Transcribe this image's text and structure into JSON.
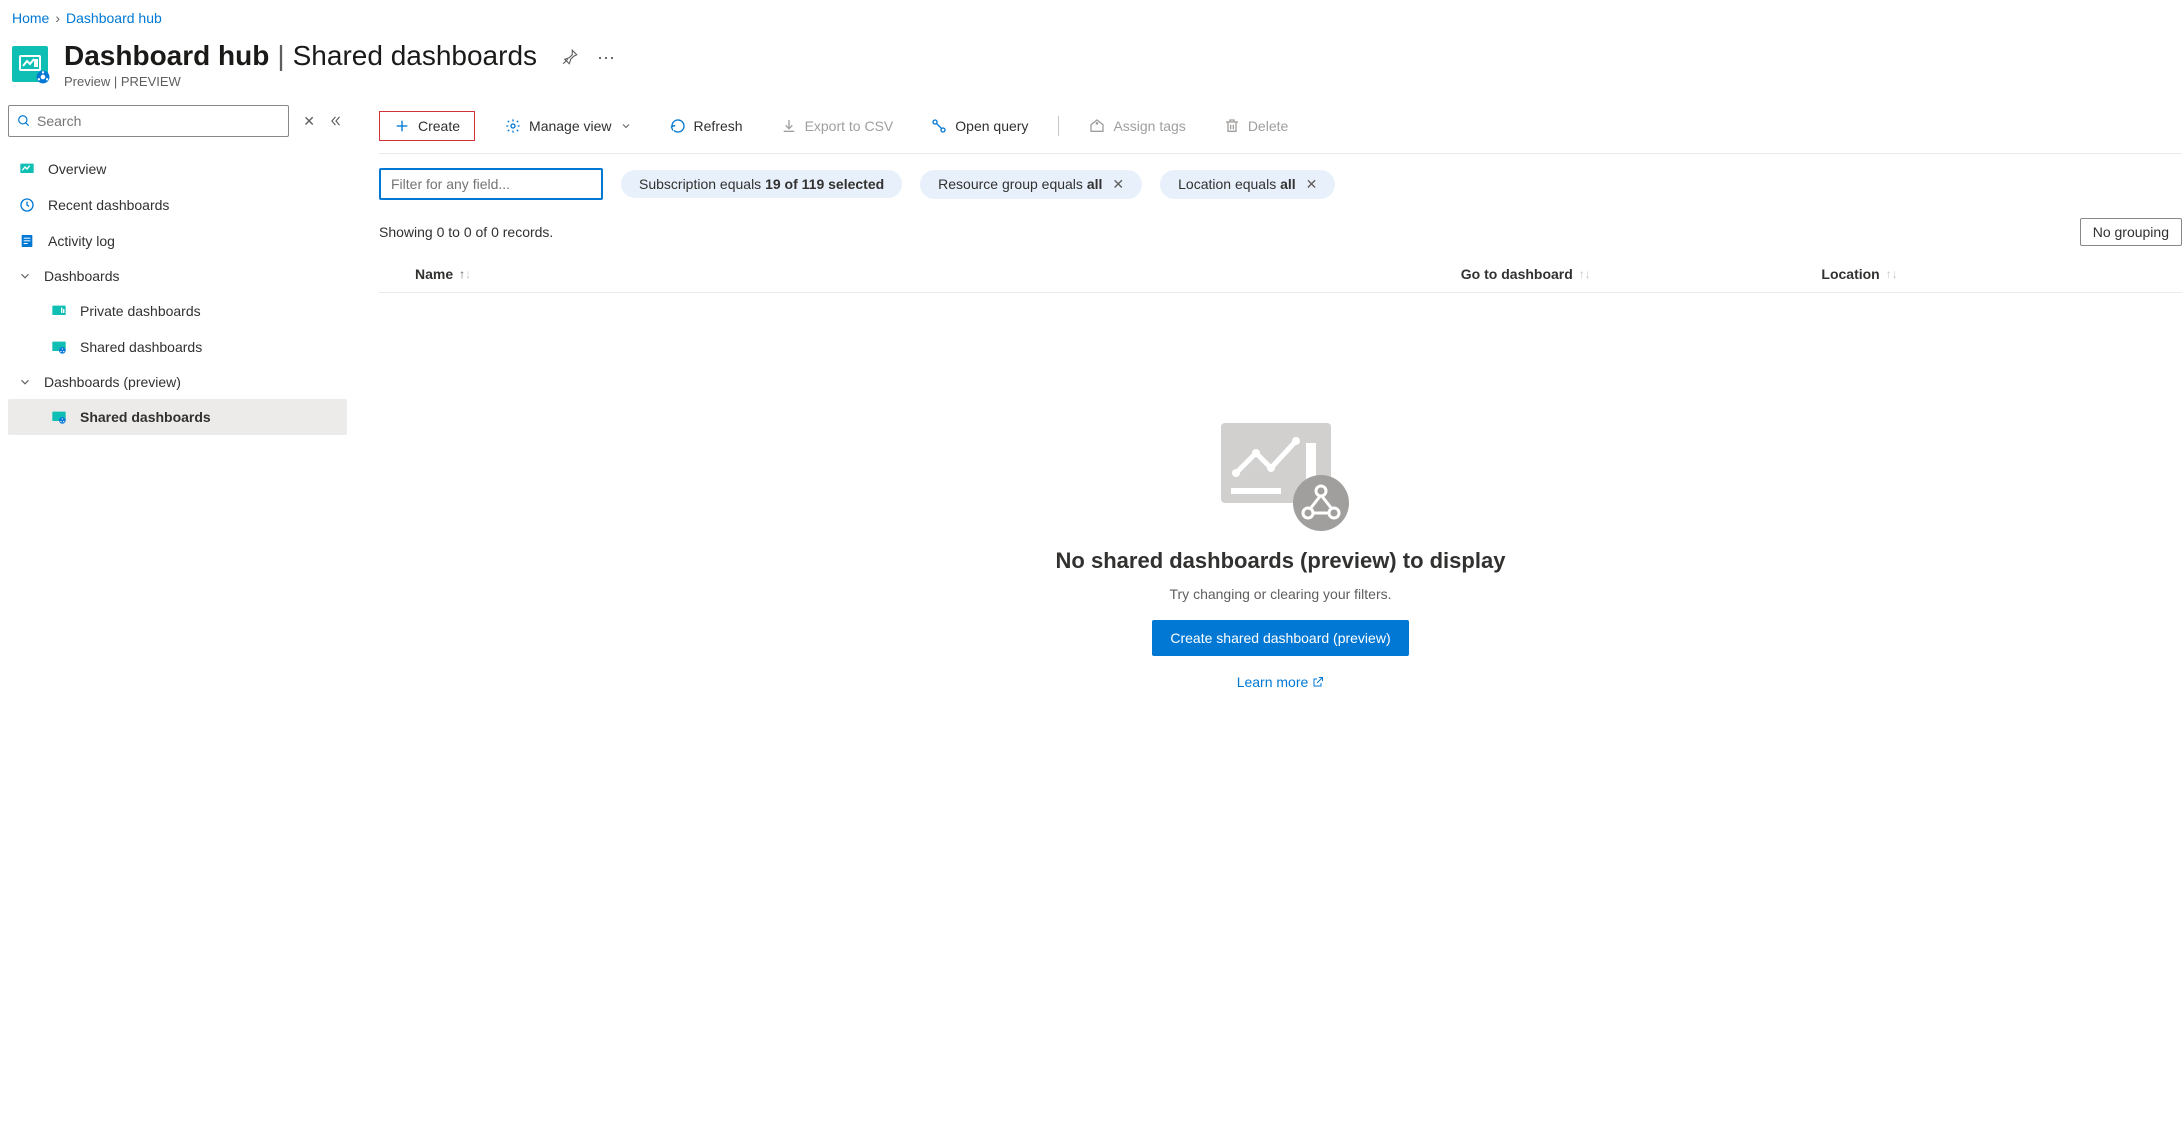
{
  "breadcrumb": {
    "home": "Home",
    "current": "Dashboard hub"
  },
  "header": {
    "title": "Dashboard hub",
    "subtitle": "Shared dashboards",
    "preview": "Preview | PREVIEW"
  },
  "sidebar": {
    "search_placeholder": "Search",
    "items_top": [
      {
        "label": "Overview"
      },
      {
        "label": "Recent dashboards"
      },
      {
        "label": "Activity log"
      }
    ],
    "group1": {
      "label": "Dashboards",
      "items": [
        {
          "label": "Private dashboards"
        },
        {
          "label": "Shared dashboards"
        }
      ]
    },
    "group2": {
      "label": "Dashboards (preview)",
      "items": [
        {
          "label": "Shared dashboards"
        }
      ]
    }
  },
  "toolbar": {
    "create": "Create",
    "manage_view": "Manage view",
    "refresh": "Refresh",
    "export_csv": "Export to CSV",
    "open_query": "Open query",
    "assign_tags": "Assign tags",
    "delete": "Delete"
  },
  "filters": {
    "filter_placeholder": "Filter for any field...",
    "subscription_prefix": "Subscription equals ",
    "subscription_value": "19 of 119 selected",
    "rg_prefix": "Resource group equals ",
    "rg_value": "all",
    "loc_prefix": "Location equals ",
    "loc_value": "all"
  },
  "status": {
    "count_text": "Showing 0 to 0 of 0 records.",
    "grouping": "No grouping"
  },
  "table": {
    "col_name": "Name",
    "col_goto": "Go to dashboard",
    "col_location": "Location"
  },
  "empty": {
    "title": "No shared dashboards (preview) to display",
    "subtitle": "Try changing or clearing your filters.",
    "button": "Create shared dashboard (preview)",
    "learn_more": "Learn more"
  }
}
